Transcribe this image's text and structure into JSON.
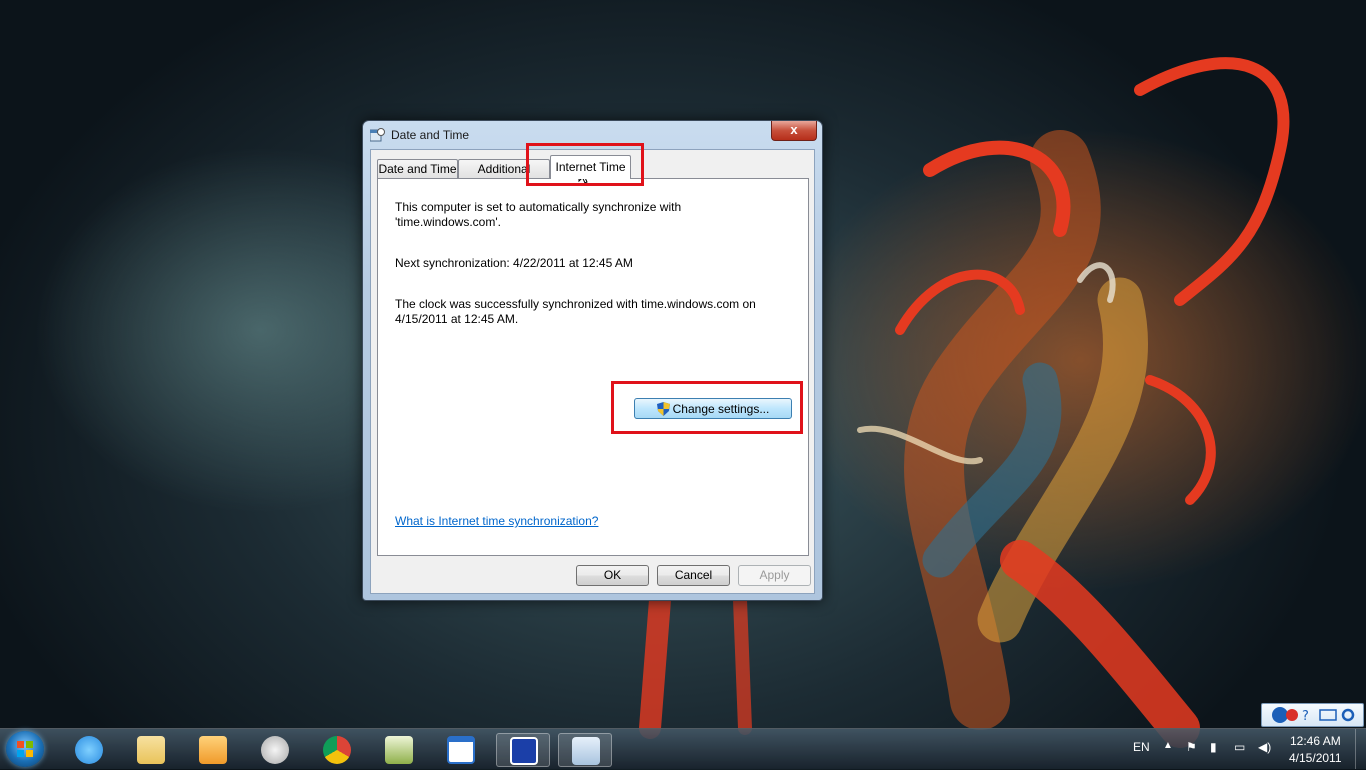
{
  "dialog": {
    "title": "Date and Time",
    "close_label": "x",
    "tabs": [
      {
        "label": "Date and Time"
      },
      {
        "label": "Additional Clocks"
      },
      {
        "label": "Internet Time",
        "active": true
      }
    ],
    "panel": {
      "line1": "This computer is set to automatically synchronize with",
      "line2": "'time.windows.com'.",
      "next_sync": "Next synchronization: 4/22/2011 at 12:45 AM",
      "status_line1": "The clock was successfully synchronized with time.windows.com on",
      "status_line2": "4/15/2011 at 12:45 AM.",
      "change_settings_label": "Change settings...",
      "help_link": "What is Internet time synchronization?"
    },
    "buttons": {
      "ok": "OK",
      "cancel": "Cancel",
      "apply": "Apply"
    }
  },
  "taskbar": {
    "apps": [
      {
        "name": "internet-explorer",
        "color": "#2a8be0"
      },
      {
        "name": "windows-explorer",
        "color": "#e9c35a"
      },
      {
        "name": "media-player",
        "color": "#f09a2a"
      },
      {
        "name": "system-clock-app",
        "color": "#c9c9c9"
      },
      {
        "name": "chrome",
        "color": "#db4437"
      },
      {
        "name": "notepad-edit",
        "color": "#8fb04a"
      },
      {
        "name": "blank-window",
        "color": "#e8eef6"
      },
      {
        "name": "remote-desktop",
        "color": "#1b3fa8"
      },
      {
        "name": "control-panel-date-time",
        "color": "#a9c4df"
      }
    ],
    "language": "EN",
    "clock_time": "12:46 AM",
    "clock_date": "4/15/2011"
  },
  "colors": {
    "annotation_red": "#e0121a",
    "link_blue": "#0066cc"
  }
}
